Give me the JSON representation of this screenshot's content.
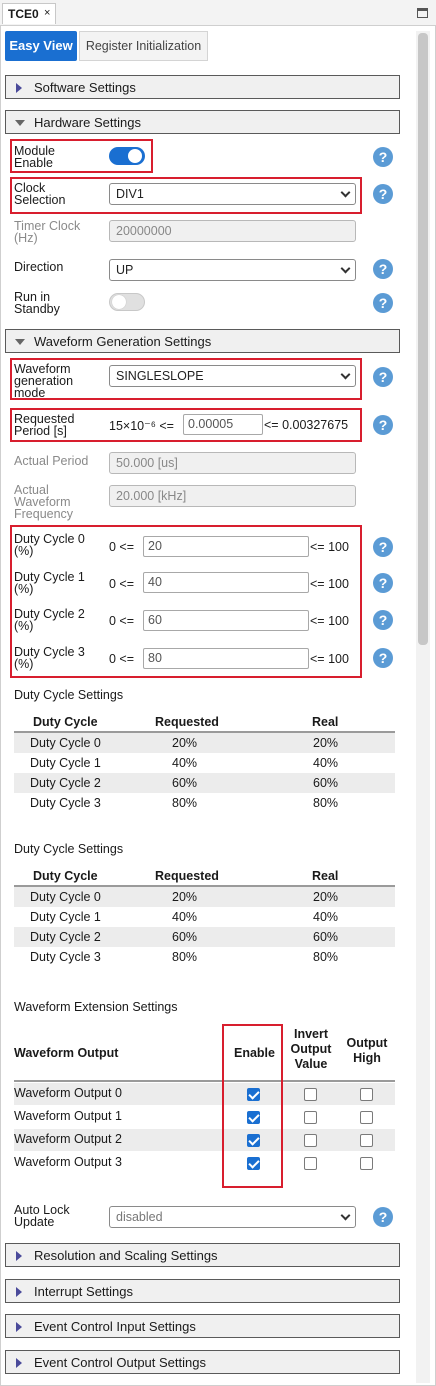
{
  "window": {
    "tab_title": "TCE0",
    "tab_close": "×"
  },
  "view_tabs": {
    "easy_view": "Easy View",
    "register_init": "Register Initialization"
  },
  "sections": {
    "software": "Software Settings",
    "hardware": "Hardware Settings",
    "waveform_gen": "Waveform Generation Settings",
    "resolution": "Resolution and Scaling Settings",
    "interrupt": "Interrupt Settings",
    "event_input": "Event Control Input Settings",
    "event_output": "Event Control Output Settings"
  },
  "hardware": {
    "module_enable": {
      "label1": "Module",
      "label2": "Enable",
      "value": true
    },
    "clock_selection": {
      "label1": "Clock",
      "label2": "Selection",
      "value": "DIV1"
    },
    "timer_clock": {
      "label1": "Timer Clock",
      "label2": "(Hz)",
      "value": "20000000"
    },
    "direction": {
      "label": "Direction",
      "value": "UP"
    },
    "run_in_standby": {
      "label1": "Run in",
      "label2": "Standby",
      "value": false
    }
  },
  "waveform": {
    "mode": {
      "label1": "Waveform",
      "label2": "generation",
      "label3": "mode",
      "value": "SINGLESLOPE"
    },
    "requested_period": {
      "label1": "Requested",
      "label2": "Period [s]",
      "min_prefix": "15×10⁻⁶ <=",
      "value": "0.00005",
      "max_suffix": "<= 0.00327675"
    },
    "actual_period": {
      "label": "Actual Period",
      "value": "50.000 [us]"
    },
    "actual_freq": {
      "label1": "Actual",
      "label2": "Waveform",
      "label3": "Frequency",
      "value": "20.000 [kHz]"
    },
    "duty_cycles": [
      {
        "label1": "Duty Cycle 0",
        "label2": "(%)",
        "min": "0 <=",
        "value": "20",
        "max": "<= 100"
      },
      {
        "label1": "Duty Cycle 1",
        "label2": "(%)",
        "min": "0 <=",
        "value": "40",
        "max": "<= 100"
      },
      {
        "label1": "Duty Cycle 2",
        "label2": "(%)",
        "min": "0 <=",
        "value": "60",
        "max": "<= 100"
      },
      {
        "label1": "Duty Cycle 3",
        "label2": "(%)",
        "min": "0 <=",
        "value": "80",
        "max": "<= 100"
      }
    ]
  },
  "duty_table": {
    "title": "Duty Cycle Settings",
    "headers": [
      "Duty Cycle",
      "Requested",
      "Real"
    ],
    "rows": [
      [
        "Duty Cycle 0",
        "20%",
        "20%"
      ],
      [
        "Duty Cycle 1",
        "40%",
        "40%"
      ],
      [
        "Duty Cycle 2",
        "60%",
        "60%"
      ],
      [
        "Duty Cycle 3",
        "80%",
        "80%"
      ]
    ]
  },
  "duty_table_2": {
    "title": "Duty Cycle Settings",
    "headers": [
      "Duty Cycle",
      "Requested",
      "Real"
    ],
    "rows": [
      [
        "Duty Cycle 0",
        "20%",
        "20%"
      ],
      [
        "Duty Cycle 1",
        "40%",
        "40%"
      ],
      [
        "Duty Cycle 2",
        "60%",
        "60%"
      ],
      [
        "Duty Cycle 3",
        "80%",
        "80%"
      ]
    ]
  },
  "extension": {
    "title": "Waveform Extension Settings",
    "headers": {
      "output": "Waveform Output",
      "enable": "Enable",
      "invert1": "Invert",
      "invert2": "Output",
      "invert3": "Value",
      "high1": "Output",
      "high2": "High"
    },
    "rows": [
      {
        "label": "Waveform Output 0",
        "enable": true,
        "invert": false,
        "high": false
      },
      {
        "label": "Waveform Output 1",
        "enable": true,
        "invert": false,
        "high": false
      },
      {
        "label": "Waveform Output 2",
        "enable": true,
        "invert": false,
        "high": false
      },
      {
        "label": "Waveform Output 3",
        "enable": true,
        "invert": false,
        "high": false
      }
    ]
  },
  "auto_lock": {
    "label1": "Auto Lock",
    "label2": "Update",
    "value": "disabled"
  },
  "help_glyph": "?",
  "colors": {
    "accent": "#1a6fd1",
    "highlight_border": "#d81e2e",
    "help": "#5b9bd5"
  }
}
